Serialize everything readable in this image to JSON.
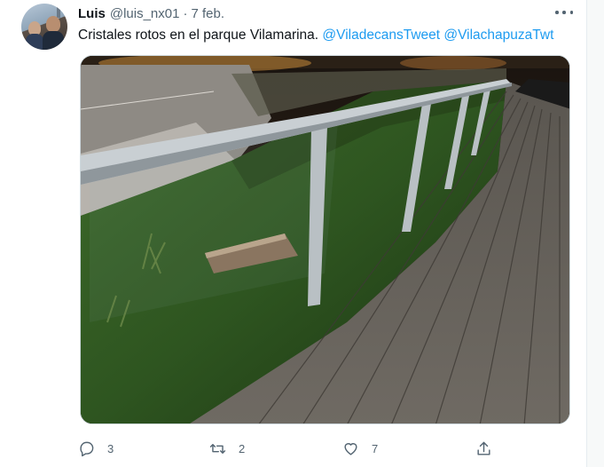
{
  "tweet": {
    "author_name": "Luis",
    "author_handle": "@luis_nx01",
    "separator": "·",
    "date": "7 feb.",
    "text": "Cristales rotos en el parque Vilamarina.",
    "mentions": [
      "@ViladecansTweet",
      "@VilachapuzaTwt"
    ]
  },
  "actions": {
    "replies": "3",
    "retweets": "2",
    "likes": "7"
  },
  "icons": {
    "avatar": "user-avatar",
    "more": "more-options-icon",
    "reply": "reply-icon",
    "retweet": "retweet-icon",
    "like": "heart-icon",
    "share": "share-icon"
  },
  "colors": {
    "mention": "#1d9bf0",
    "secondary_text": "#536471",
    "primary_text": "#0f1419"
  }
}
